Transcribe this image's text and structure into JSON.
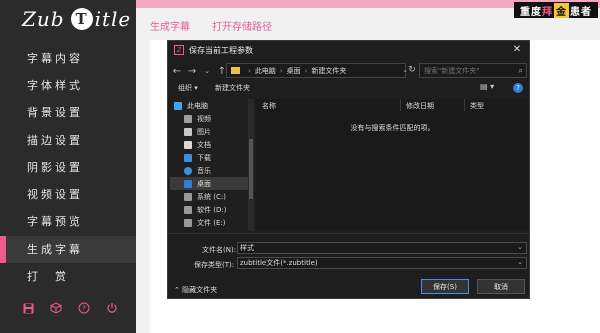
{
  "app": {
    "logo": {
      "left": "Zub",
      "t_letter": "T",
      "right": "itle"
    },
    "brand_badge": {
      "part1": "重度",
      "part2": "拜",
      "part3": "金",
      "part4": "患者"
    },
    "sidebar": {
      "items": [
        {
          "label": "字幕内容"
        },
        {
          "label": "字体样式"
        },
        {
          "label": "背景设置"
        },
        {
          "label": "描边设置"
        },
        {
          "label": "阴影设置"
        },
        {
          "label": "视频设置"
        },
        {
          "label": "字幕预览"
        },
        {
          "label": "生成字幕",
          "active": true
        },
        {
          "label": "打　赏"
        }
      ],
      "bottom_icons": [
        "save-icon",
        "cube-icon",
        "help-icon",
        "power-icon"
      ]
    },
    "top_tabs": [
      {
        "label": "生成字幕"
      },
      {
        "label": "打开存储路径"
      }
    ],
    "accent_color": "#f05a8c"
  },
  "dialog": {
    "title": "保存当前工程参数",
    "app_icon_glyph": "Z",
    "address": {
      "segments": [
        "此电脑",
        "桌面",
        "新建文件夹"
      ]
    },
    "search": {
      "placeholder": "搜索\"新建文件夹\""
    },
    "toolbar": {
      "organize": "组织 ▾",
      "new_folder": "新建文件夹"
    },
    "tree": [
      {
        "label": "此电脑",
        "icon": "computer-icon"
      },
      {
        "label": "视频",
        "icon": "video-icon"
      },
      {
        "label": "图片",
        "icon": "picture-icon"
      },
      {
        "label": "文档",
        "icon": "document-icon"
      },
      {
        "label": "下载",
        "icon": "download-icon"
      },
      {
        "label": "音乐",
        "icon": "music-icon"
      },
      {
        "label": "桌面",
        "icon": "desktop-icon",
        "selected": true
      },
      {
        "label": "系统 (C:)",
        "icon": "drive-icon"
      },
      {
        "label": "软件 (D:)",
        "icon": "drive-icon"
      },
      {
        "label": "文件 (E:)",
        "icon": "drive-icon"
      }
    ],
    "columns": [
      "名称",
      "修改日期",
      "类型"
    ],
    "empty_message": "没有与搜索条件匹配的项。",
    "filename_label": "文件名(N):",
    "filename_value": "样式",
    "filetype_label": "保存类型(T):",
    "filetype_value": "zubtitle文件(*.zubtitle)",
    "hide_folders": "隐藏文件夹",
    "save_button": "保存(S)",
    "cancel_button": "取消"
  }
}
